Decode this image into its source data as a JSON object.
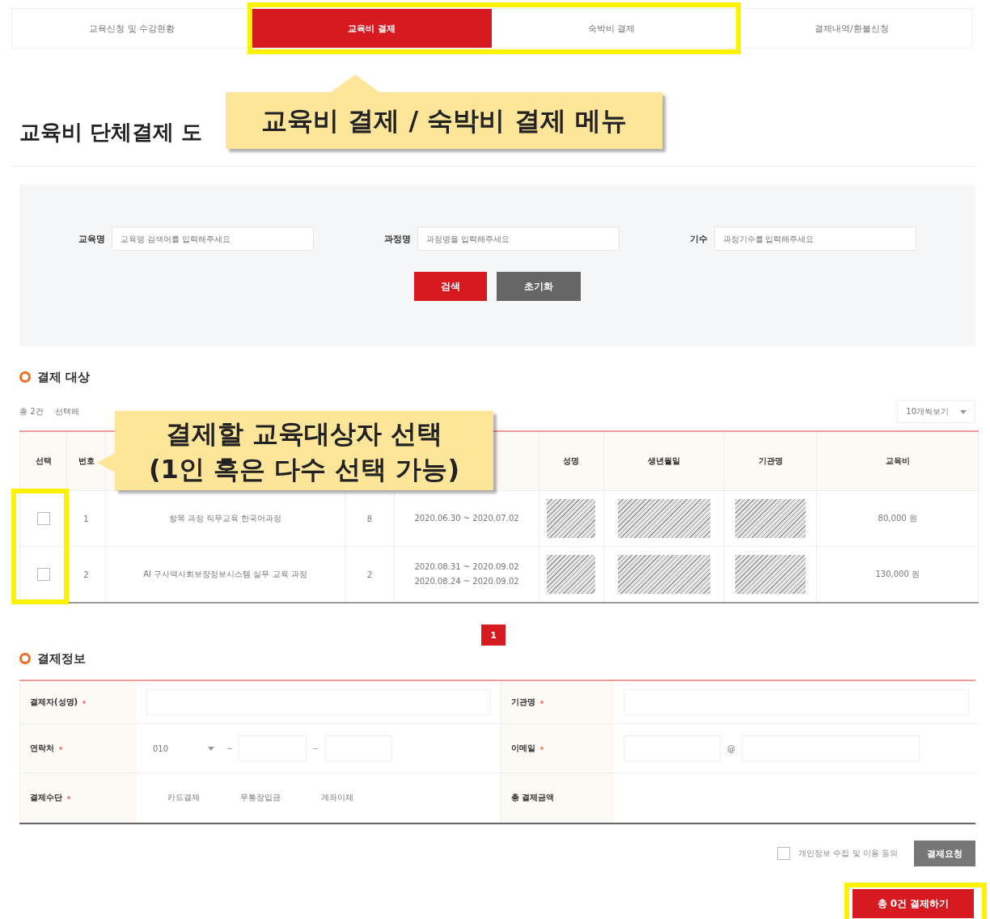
{
  "tabs": [
    {
      "label": "교육신청 및 수강현황",
      "selected": false
    },
    {
      "label": "교육비 결제",
      "selected": true
    },
    {
      "label": "숙박비 결제",
      "selected": false
    },
    {
      "label": "결제내역/환불신청",
      "selected": false
    }
  ],
  "page_title": "교육비 단체결제 도",
  "search": {
    "fields": [
      {
        "label": "교육명",
        "placeholder": "교육명 검색어를 입력해주세요"
      },
      {
        "label": "과정명",
        "placeholder": "과정명을 입력해주세요"
      },
      {
        "label": "기수",
        "placeholder": "과정기수를 입력해주세요"
      }
    ],
    "buttons": [
      {
        "label": "검색",
        "kind": "primary"
      },
      {
        "label": "초기화",
        "kind": "secondary"
      }
    ]
  },
  "targets": {
    "heading": "결제 대상",
    "count": "총 2건",
    "note": "선택해",
    "page_size": "10개씩보기",
    "columns": [
      "선택",
      "번호",
      "",
      "",
      "",
      "성명",
      "생년월일",
      "기관명",
      "교육비"
    ],
    "rows": [
      {
        "checked": false,
        "no": "1",
        "course": "항목 과정 직무교육 한국어과정",
        "cohort": "8",
        "periods": [
          "2020.06.30 ~ 2020.07.02"
        ],
        "fee": "80,000 원"
      },
      {
        "checked": false,
        "no": "2",
        "course": "AI 구사역사회보장정보시스템 실무 교육 과정",
        "cohort": "2",
        "periods": [
          "2020.08.31 ~ 2020.09.02",
          "2020.08.24 ~ 2020.09.02"
        ],
        "fee": "130,000 원"
      }
    ],
    "pages": [
      {
        "label": "1",
        "selected": true
      }
    ]
  },
  "payment": {
    "heading": "결제정보",
    "payer_label": "결제자(성명)",
    "org_label": "기관명",
    "phone_label": "연락처",
    "phone_prefix": "010",
    "email_label": "이메일",
    "email_at": "@",
    "method_label": "결제수단",
    "methods": [
      "카드결제",
      "무통장입금",
      "계좌이체"
    ],
    "total_label": "총 결제금액"
  },
  "agreement": {
    "label": "개인정보 수집 및 이용 동의",
    "checked": false,
    "button": "결제요청"
  },
  "pay_button": "총 0건 결제하기",
  "callouts": [
    {
      "text": "교육비 결제 / 숙박비 결제 메뉴"
    },
    {
      "text": "결제할 교육대상자 선택\n(1인 혹은 다수 선택 가능)"
    }
  ]
}
